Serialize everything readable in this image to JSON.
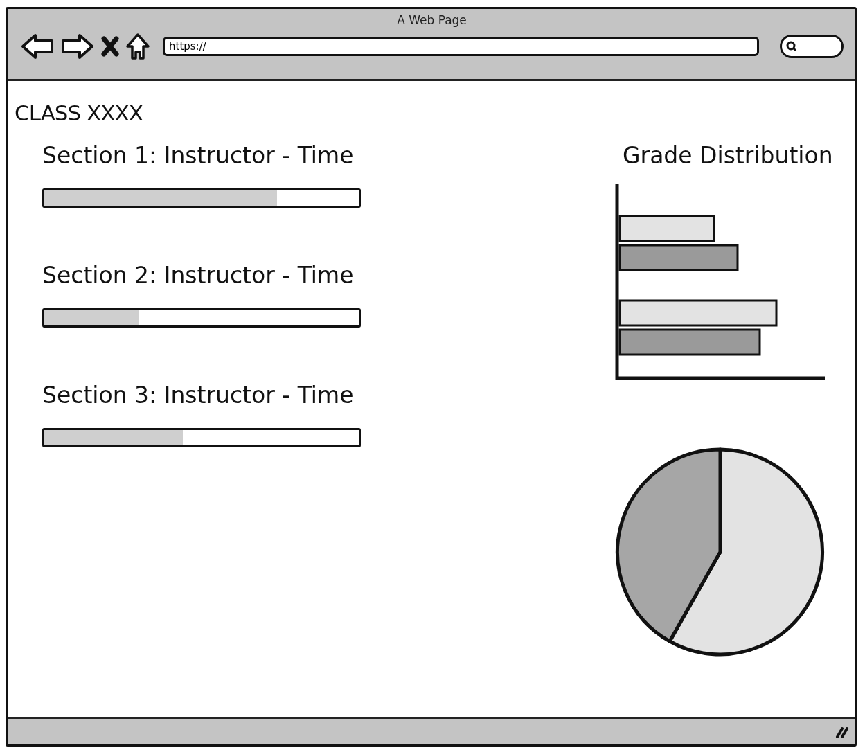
{
  "window": {
    "title": "A Web Page"
  },
  "address_bar": {
    "value": "https://"
  },
  "page": {
    "title": "CLASS XXXX"
  },
  "sections": [
    {
      "heading": "Section 1: Instructor - Time",
      "level": 0.74
    },
    {
      "heading": "Section 2: Instructor - Time",
      "level": 0.3
    },
    {
      "heading": "Section 3: Instructor - Time",
      "level": 0.44
    }
  ],
  "grade_panel": {
    "title": "Grade Distribution"
  }
}
